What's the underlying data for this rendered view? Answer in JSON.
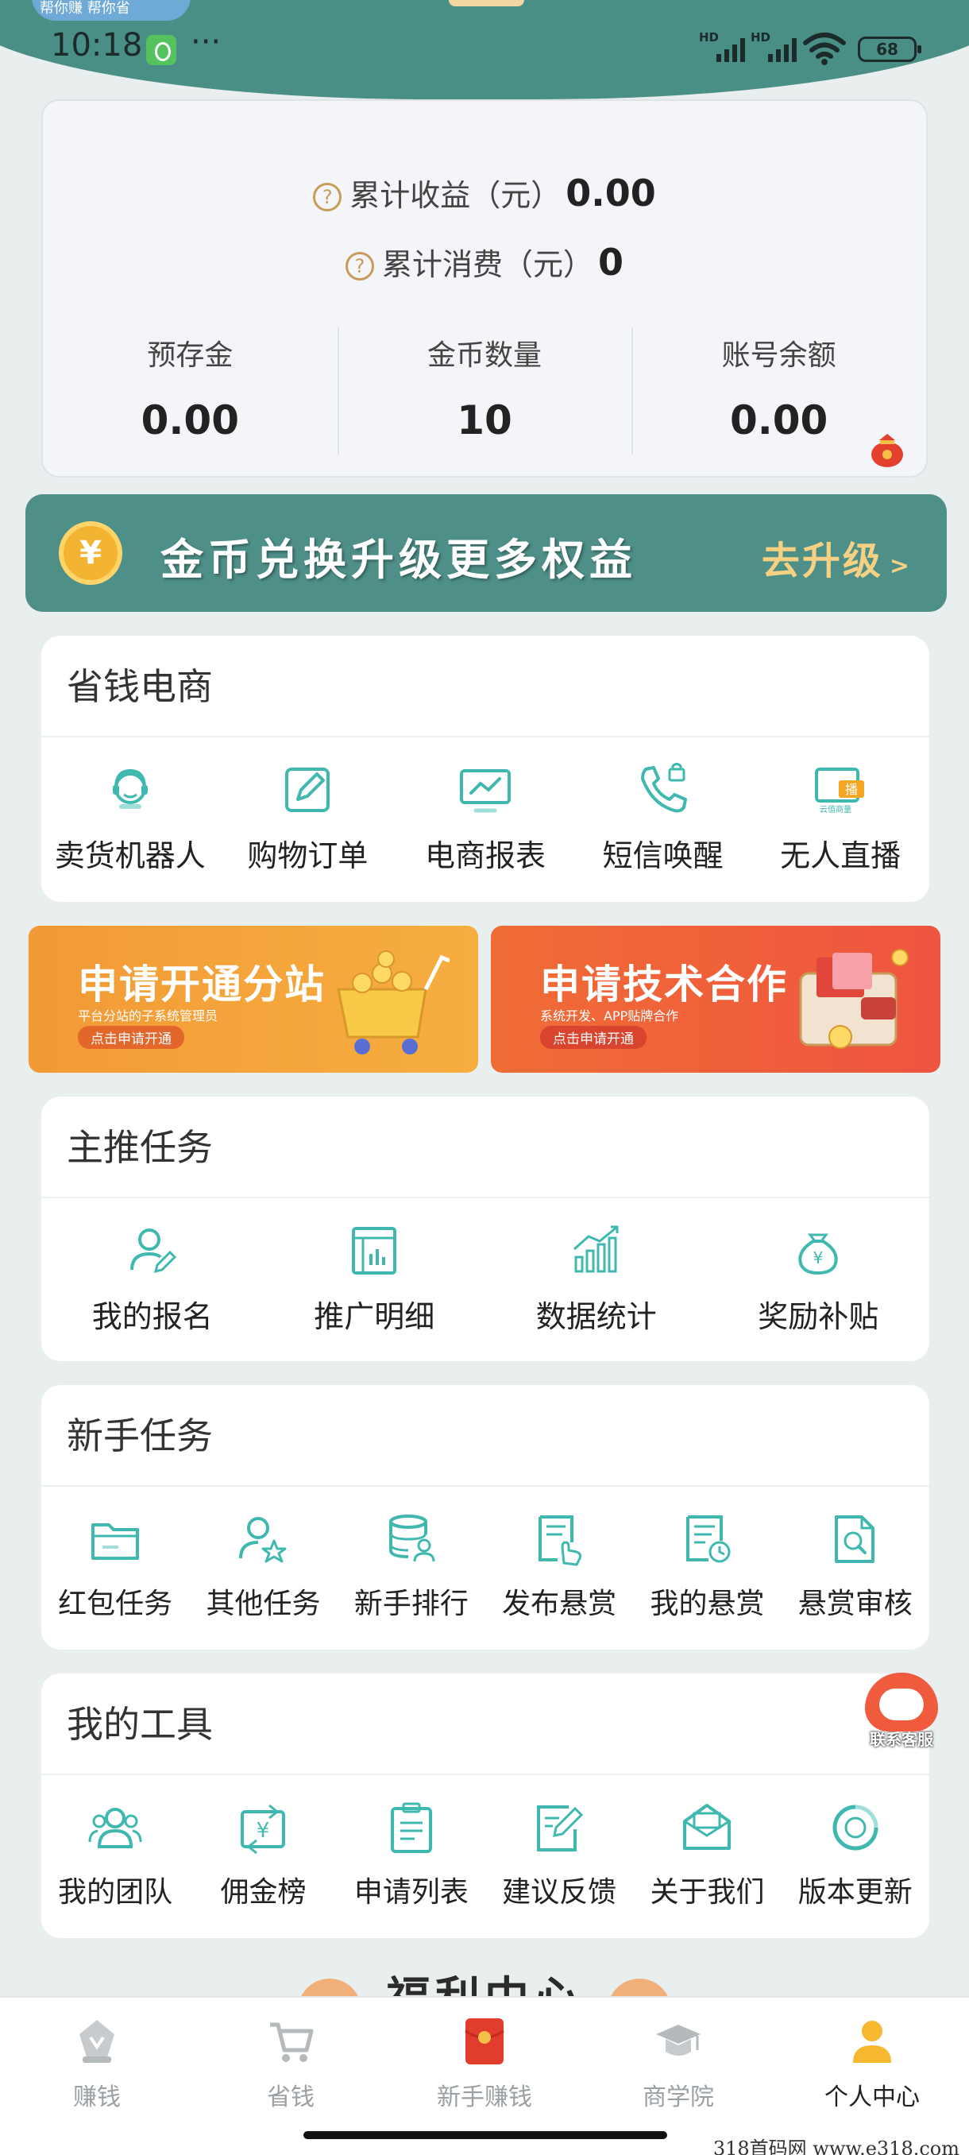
{
  "status_bar": {
    "time": "10:18",
    "network_1": "HD",
    "network_2": "HD",
    "battery": "68"
  },
  "header_partial": {
    "chip_text": "帮你赚 帮你省"
  },
  "stats": {
    "total_income_label": "累计收益（元）",
    "total_income_value": "0.00",
    "total_spend_label": "累计消费（元）",
    "total_spend_value": "0",
    "columns": [
      {
        "label": "预存金",
        "value": "0.00"
      },
      {
        "label": "金币数量",
        "value": "10"
      },
      {
        "label": "账号余额",
        "value": "0.00"
      }
    ]
  },
  "upgrade": {
    "coin_symbol": "¥",
    "text": "金币兑换升级更多权益",
    "button": "去升级",
    "arrow": ">"
  },
  "ecommerce": {
    "title": "省钱电商",
    "items": [
      {
        "label": "卖货机器人",
        "icon": "robot-icon"
      },
      {
        "label": "购物订单",
        "icon": "edit-icon"
      },
      {
        "label": "电商报表",
        "icon": "chart-monitor-icon"
      },
      {
        "label": "短信唤醒",
        "icon": "phone-lock-icon"
      },
      {
        "label": "无人直播",
        "icon": "live-icon"
      }
    ]
  },
  "promos": {
    "left": {
      "title": "申请开通分站",
      "subtitle": "平台分站的子系统管理员",
      "button": "点击申请开通"
    },
    "right": {
      "title": "申请技术合作",
      "subtitle": "系统开发、APP贴牌合作",
      "button": "点击申请开通"
    }
  },
  "main_tasks": {
    "title": "主推任务",
    "items": [
      {
        "label": "我的报名",
        "icon": "user-edit-icon"
      },
      {
        "label": "推广明细",
        "icon": "report-icon"
      },
      {
        "label": "数据统计",
        "icon": "stats-icon"
      },
      {
        "label": "奖励补贴",
        "icon": "money-bag-icon"
      }
    ]
  },
  "newbie_tasks": {
    "title": "新手任务",
    "items": [
      {
        "label": "红包任务",
        "icon": "folder-icon"
      },
      {
        "label": "其他任务",
        "icon": "user-star-icon"
      },
      {
        "label": "新手排行",
        "icon": "database-user-icon"
      },
      {
        "label": "发布悬赏",
        "icon": "doc-hand-icon"
      },
      {
        "label": "我的悬赏",
        "icon": "doc-clock-icon"
      },
      {
        "label": "悬赏审核",
        "icon": "doc-search-icon"
      }
    ]
  },
  "tools": {
    "title": "我的工具",
    "items": [
      {
        "label": "我的团队",
        "icon": "team-icon"
      },
      {
        "label": "佣金榜",
        "icon": "commission-icon"
      },
      {
        "label": "申请列表",
        "icon": "clipboard-icon"
      },
      {
        "label": "建议反馈",
        "icon": "feedback-icon"
      },
      {
        "label": "关于我们",
        "icon": "mail-icon"
      },
      {
        "label": "版本更新",
        "icon": "update-icon"
      }
    ]
  },
  "service": {
    "label": "联系客服"
  },
  "welfare": {
    "title": "福利中心"
  },
  "bottom_nav": [
    {
      "label": "赚钱",
      "icon": "earn-icon"
    },
    {
      "label": "省钱",
      "icon": "cart-icon"
    },
    {
      "label": "新手赚钱",
      "icon": "red-envelope-icon"
    },
    {
      "label": "商学院",
      "icon": "graduation-cap-icon"
    },
    {
      "label": "个人中心",
      "icon": "person-icon",
      "active": true
    }
  ],
  "watermark": "318首码网  www.e318.com",
  "colors": {
    "teal": "#4a8f86",
    "icon_teal": "#3fb8b0",
    "gold": "#f6d184",
    "orange": "#f29a36",
    "red": "#ef5540"
  }
}
